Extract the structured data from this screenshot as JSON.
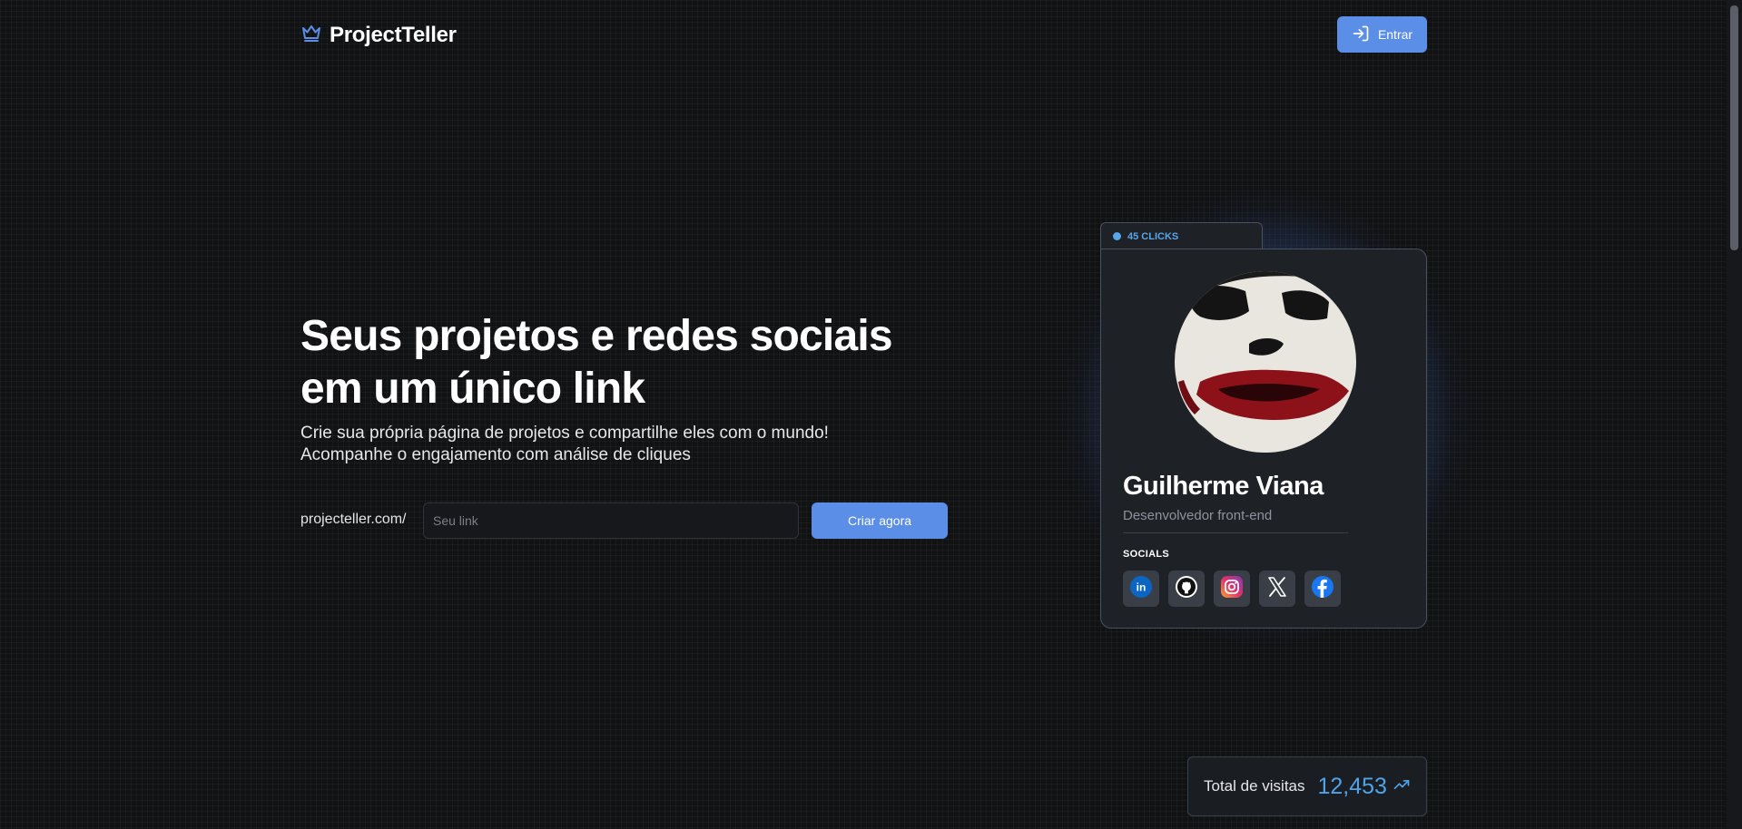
{
  "header": {
    "logo_icon": "crown-icon",
    "brand": "ProjectTeller",
    "login_icon": "login-arrow-icon",
    "login_label": "Entrar"
  },
  "hero": {
    "title": "Seus projetos e redes sociais em um único link",
    "subtitle_line1": "Crie sua própria página de projetos e compartilhe eles com o mundo!",
    "subtitle_line2": "Acompanhe o engajamento com análise de cliques",
    "url_prefix": "projecteller.com/",
    "link_input": {
      "value": "",
      "placeholder": "Seu link"
    },
    "create_label": "Criar agora"
  },
  "profile_card": {
    "clicks": "45 CLICKS",
    "name": "Guilherme Viana",
    "role": "Desenvolvedor front-end",
    "socials_label": "SOCIALS",
    "socials": [
      {
        "icon": "linkedin-icon"
      },
      {
        "icon": "github-icon"
      },
      {
        "icon": "instagram-icon"
      },
      {
        "icon": "x-icon"
      },
      {
        "icon": "facebook-icon"
      }
    ]
  },
  "stats": {
    "visits_label": "Total de visitas",
    "visits_value": "12,453",
    "trend_icon": "trending-up-icon"
  },
  "colors": {
    "background": "#111214",
    "accent": "#5b8ee6",
    "highlight": "#4ea4ea",
    "card": "#1e2126"
  }
}
